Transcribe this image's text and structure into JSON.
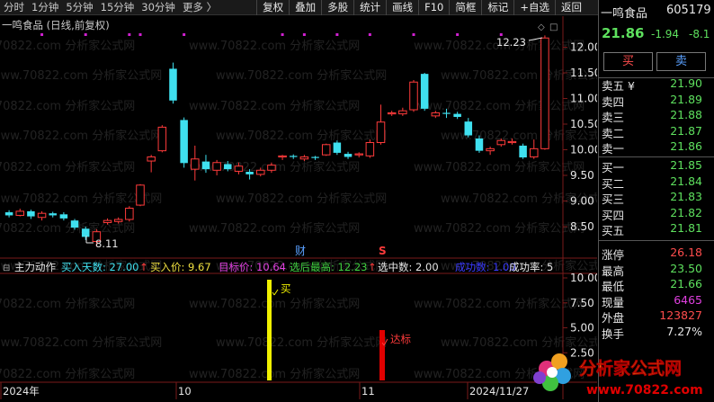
{
  "toolbar": {
    "periods": [
      "分时",
      "1分钟",
      "5分钟",
      "15分钟",
      "30分钟",
      "更多 〉"
    ],
    "tools": [
      "复权",
      "叠加",
      "多股",
      "统计",
      "画线",
      "F10",
      "简框",
      "标记",
      "+自选",
      "返回"
    ]
  },
  "chart": {
    "title": "一鸣食品 (日线,前复权)",
    "price_axis": [
      "12.00",
      "11.50",
      "11.00",
      "10.50",
      "10.00",
      "9.50",
      "9.00",
      "8.50"
    ],
    "high_label": "12.23",
    "low_label": "8.11",
    "event_cai": "财",
    "event_s": "S",
    "watermark": "www.70822.com 分析家公式网",
    "colors": {
      "up": "#ff3b3b",
      "down": "#3fe0ef",
      "bg": "#000000",
      "grid": "#6b1a1a"
    }
  },
  "chart_data": {
    "type": "candlestick",
    "candles": [
      {
        "o": 8.78,
        "c": 8.72,
        "h": 8.82,
        "l": 8.68
      },
      {
        "o": 8.72,
        "c": 8.8,
        "h": 8.85,
        "l": 8.7
      },
      {
        "o": 8.8,
        "c": 8.7,
        "h": 8.83,
        "l": 8.65
      },
      {
        "o": 8.68,
        "c": 8.76,
        "h": 8.8,
        "l": 8.62
      },
      {
        "o": 8.76,
        "c": 8.72,
        "h": 8.79,
        "l": 8.68
      },
      {
        "o": 8.74,
        "c": 8.66,
        "h": 8.78,
        "l": 8.62
      },
      {
        "o": 8.62,
        "c": 8.48,
        "h": 8.65,
        "l": 8.44
      },
      {
        "o": 8.46,
        "c": 8.3,
        "h": 8.5,
        "l": 8.24
      },
      {
        "o": 8.21,
        "c": 8.4,
        "h": 8.45,
        "l": 8.11
      },
      {
        "o": 8.58,
        "c": 8.62,
        "h": 8.66,
        "l": 8.54
      },
      {
        "o": 8.6,
        "c": 8.64,
        "h": 8.68,
        "l": 8.56
      },
      {
        "o": 8.64,
        "c": 8.86,
        "h": 8.9,
        "l": 8.6
      },
      {
        "o": 8.92,
        "c": 9.31,
        "h": 9.33,
        "l": 8.9
      },
      {
        "o": 9.78,
        "c": 9.86,
        "h": 9.9,
        "l": 9.56
      },
      {
        "o": 9.98,
        "c": 10.44,
        "h": 10.48,
        "l": 9.95
      },
      {
        "o": 11.58,
        "c": 10.96,
        "h": 11.7,
        "l": 10.9
      },
      {
        "o": 10.58,
        "c": 9.74,
        "h": 10.63,
        "l": 9.65
      },
      {
        "o": 9.62,
        "c": 9.82,
        "h": 10.08,
        "l": 9.4
      },
      {
        "o": 9.77,
        "c": 9.62,
        "h": 9.9,
        "l": 9.55
      },
      {
        "o": 9.6,
        "c": 9.75,
        "h": 9.8,
        "l": 9.5
      },
      {
        "o": 9.72,
        "c": 9.62,
        "h": 9.78,
        "l": 9.58
      },
      {
        "o": 9.58,
        "c": 9.68,
        "h": 9.75,
        "l": 9.52
      },
      {
        "o": 9.57,
        "c": 9.52,
        "h": 9.62,
        "l": 9.42
      },
      {
        "o": 9.52,
        "c": 9.6,
        "h": 9.65,
        "l": 9.48
      },
      {
        "o": 9.6,
        "c": 9.7,
        "h": 9.75,
        "l": 9.55
      },
      {
        "o": 9.86,
        "c": 9.88,
        "h": 9.9,
        "l": 9.8
      },
      {
        "o": 9.88,
        "c": 9.86,
        "h": 9.91,
        "l": 9.82
      },
      {
        "o": 9.82,
        "c": 9.86,
        "h": 9.9,
        "l": 9.78
      },
      {
        "o": 9.86,
        "c": 9.84,
        "h": 9.88,
        "l": 9.8
      },
      {
        "o": 9.9,
        "c": 10.1,
        "h": 10.12,
        "l": 9.88
      },
      {
        "o": 10.14,
        "c": 9.94,
        "h": 10.18,
        "l": 9.9
      },
      {
        "o": 9.92,
        "c": 9.86,
        "h": 9.96,
        "l": 9.82
      },
      {
        "o": 9.9,
        "c": 9.92,
        "h": 9.95,
        "l": 9.85
      },
      {
        "o": 9.88,
        "c": 10.14,
        "h": 10.2,
        "l": 9.84
      },
      {
        "o": 10.14,
        "c": 10.54,
        "h": 10.88,
        "l": 10.1
      },
      {
        "o": 10.7,
        "c": 10.72,
        "h": 10.76,
        "l": 10.66
      },
      {
        "o": 10.7,
        "c": 10.76,
        "h": 10.82,
        "l": 10.66
      },
      {
        "o": 10.78,
        "c": 11.32,
        "h": 11.36,
        "l": 10.74
      },
      {
        "o": 11.48,
        "c": 10.8,
        "h": 11.5,
        "l": 10.76
      },
      {
        "o": 10.66,
        "c": 10.72,
        "h": 10.76,
        "l": 10.62
      },
      {
        "o": 10.72,
        "c": 10.7,
        "h": 10.8,
        "l": 10.62
      },
      {
        "o": 10.7,
        "c": 10.64,
        "h": 10.74,
        "l": 10.6
      },
      {
        "o": 10.55,
        "c": 10.28,
        "h": 10.62,
        "l": 10.24
      },
      {
        "o": 10.22,
        "c": 9.98,
        "h": 10.28,
        "l": 9.94
      },
      {
        "o": 9.98,
        "c": 10.02,
        "h": 10.06,
        "l": 9.9
      },
      {
        "o": 10.1,
        "c": 10.18,
        "h": 10.22,
        "l": 10.06
      },
      {
        "o": 10.14,
        "c": 10.16,
        "h": 10.22,
        "l": 10.1
      },
      {
        "o": 10.08,
        "c": 9.85,
        "h": 10.12,
        "l": 9.82
      },
      {
        "o": 9.86,
        "c": 10.02,
        "h": 10.2,
        "l": 9.82
      },
      {
        "o": 10.02,
        "c": 12.18,
        "h": 12.23,
        "l": 10.0
      }
    ],
    "ylim": [
      8.1,
      12.35
    ]
  },
  "indicator": {
    "name": "主力动作",
    "items": [
      {
        "label": "买入天数: 27.00",
        "color": "#3fe0ef"
      },
      {
        "label": "↑",
        "color": "#ff3b3b"
      },
      {
        "label": "买入价: 9.67",
        "color": "#f0e040"
      },
      {
        "label": "目标价: 10.64",
        "color": "#e040e0"
      },
      {
        "label": "选后最高: 12.23",
        "color": "#40d040"
      },
      {
        "label": "↑",
        "color": "#ff3b3b"
      },
      {
        "label": "选中数: 2.00",
        "color": "#e6e6e6"
      },
      {
        "label": "成功数: 1.00",
        "color": "#3a3aff"
      },
      {
        "label": "成功率: 5",
        "color": "#e6e6e6"
      }
    ],
    "axis": [
      "10.00",
      "7.50",
      "5.00",
      "2.50"
    ],
    "buy_label": "买",
    "hit_label": "达标"
  },
  "date_axis": [
    "2024年",
    "10",
    "11",
    "2024/11/27"
  ],
  "quote": {
    "name": "一鸣食品",
    "code": "605179",
    "price": "21.86",
    "change": "-1.94",
    "change_pct": "-8.1",
    "buy_label": "买",
    "sell_label": "卖",
    "asks": [
      {
        "label": "卖五 ¥",
        "price": "21.90"
      },
      {
        "label": "卖四",
        "price": "21.89"
      },
      {
        "label": "卖三",
        "price": "21.88"
      },
      {
        "label": "卖二",
        "price": "21.87"
      },
      {
        "label": "卖一",
        "price": "21.86"
      }
    ],
    "bids": [
      {
        "label": "买一",
        "price": "21.85"
      },
      {
        "label": "买二",
        "price": "21.84"
      },
      {
        "label": "买三",
        "price": "21.83"
      },
      {
        "label": "买四",
        "price": "21.82"
      },
      {
        "label": "买五",
        "price": "21.81"
      }
    ],
    "stats": [
      {
        "label": "涨停",
        "value": "26.18",
        "color": "#ff4d4d"
      },
      {
        "label": "最高",
        "value": "23.50",
        "color": "#5ee05e"
      },
      {
        "label": "最低",
        "value": "21.66",
        "color": "#5ee05e"
      },
      {
        "label": "现量",
        "value": "6465",
        "color": "#e040e0"
      },
      {
        "label": "外盘",
        "value": "123827",
        "color": "#ff4d4d"
      },
      {
        "label": "换手",
        "value": "7.27%",
        "color": "#e6e6e6"
      }
    ]
  },
  "logo": {
    "text": "分析家公式网",
    "url": "www.70822.com"
  }
}
